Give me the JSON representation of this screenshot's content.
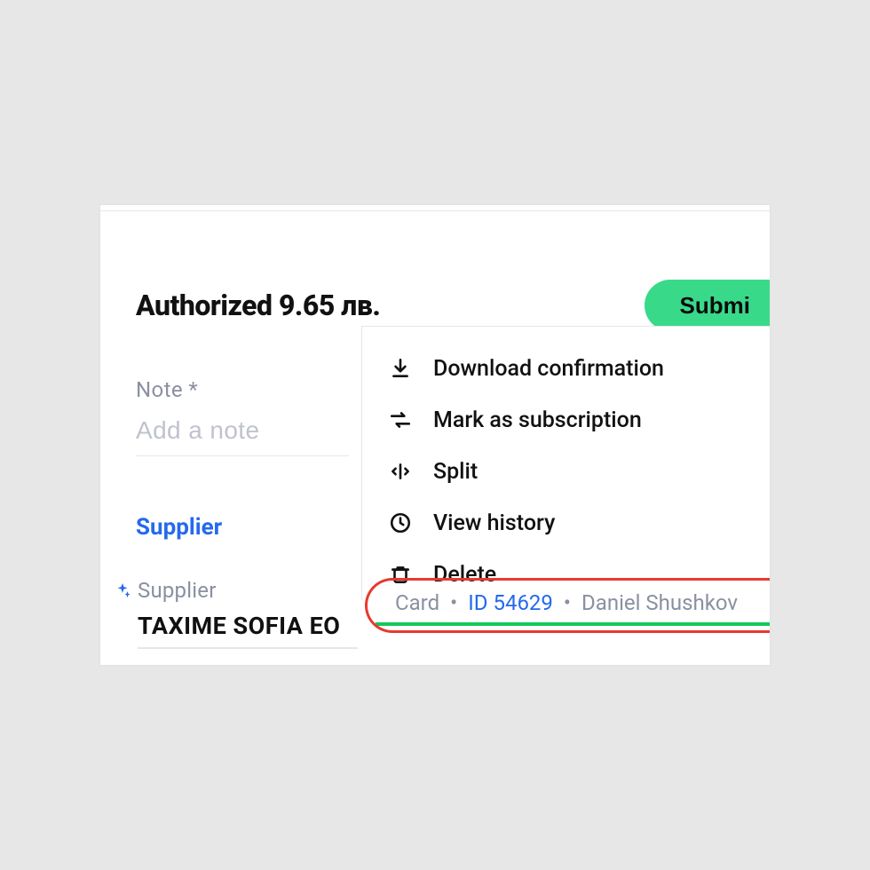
{
  "header": {
    "title": "Authorized 9.65 лв.",
    "submit_label": "Submi"
  },
  "note": {
    "label": "Note *",
    "placeholder": "Add a note"
  },
  "supplier": {
    "tab_label": "Supplier",
    "field_label": "Supplier",
    "value": "TAXIME SOFIA EO"
  },
  "menu": {
    "download": "Download confirmation",
    "subscription": "Mark as subscription",
    "split": "Split",
    "history": "View history",
    "delete": "Delete"
  },
  "card_row": {
    "prefix": "Card",
    "id": "ID 54629",
    "name": "Daniel Shushkov"
  }
}
